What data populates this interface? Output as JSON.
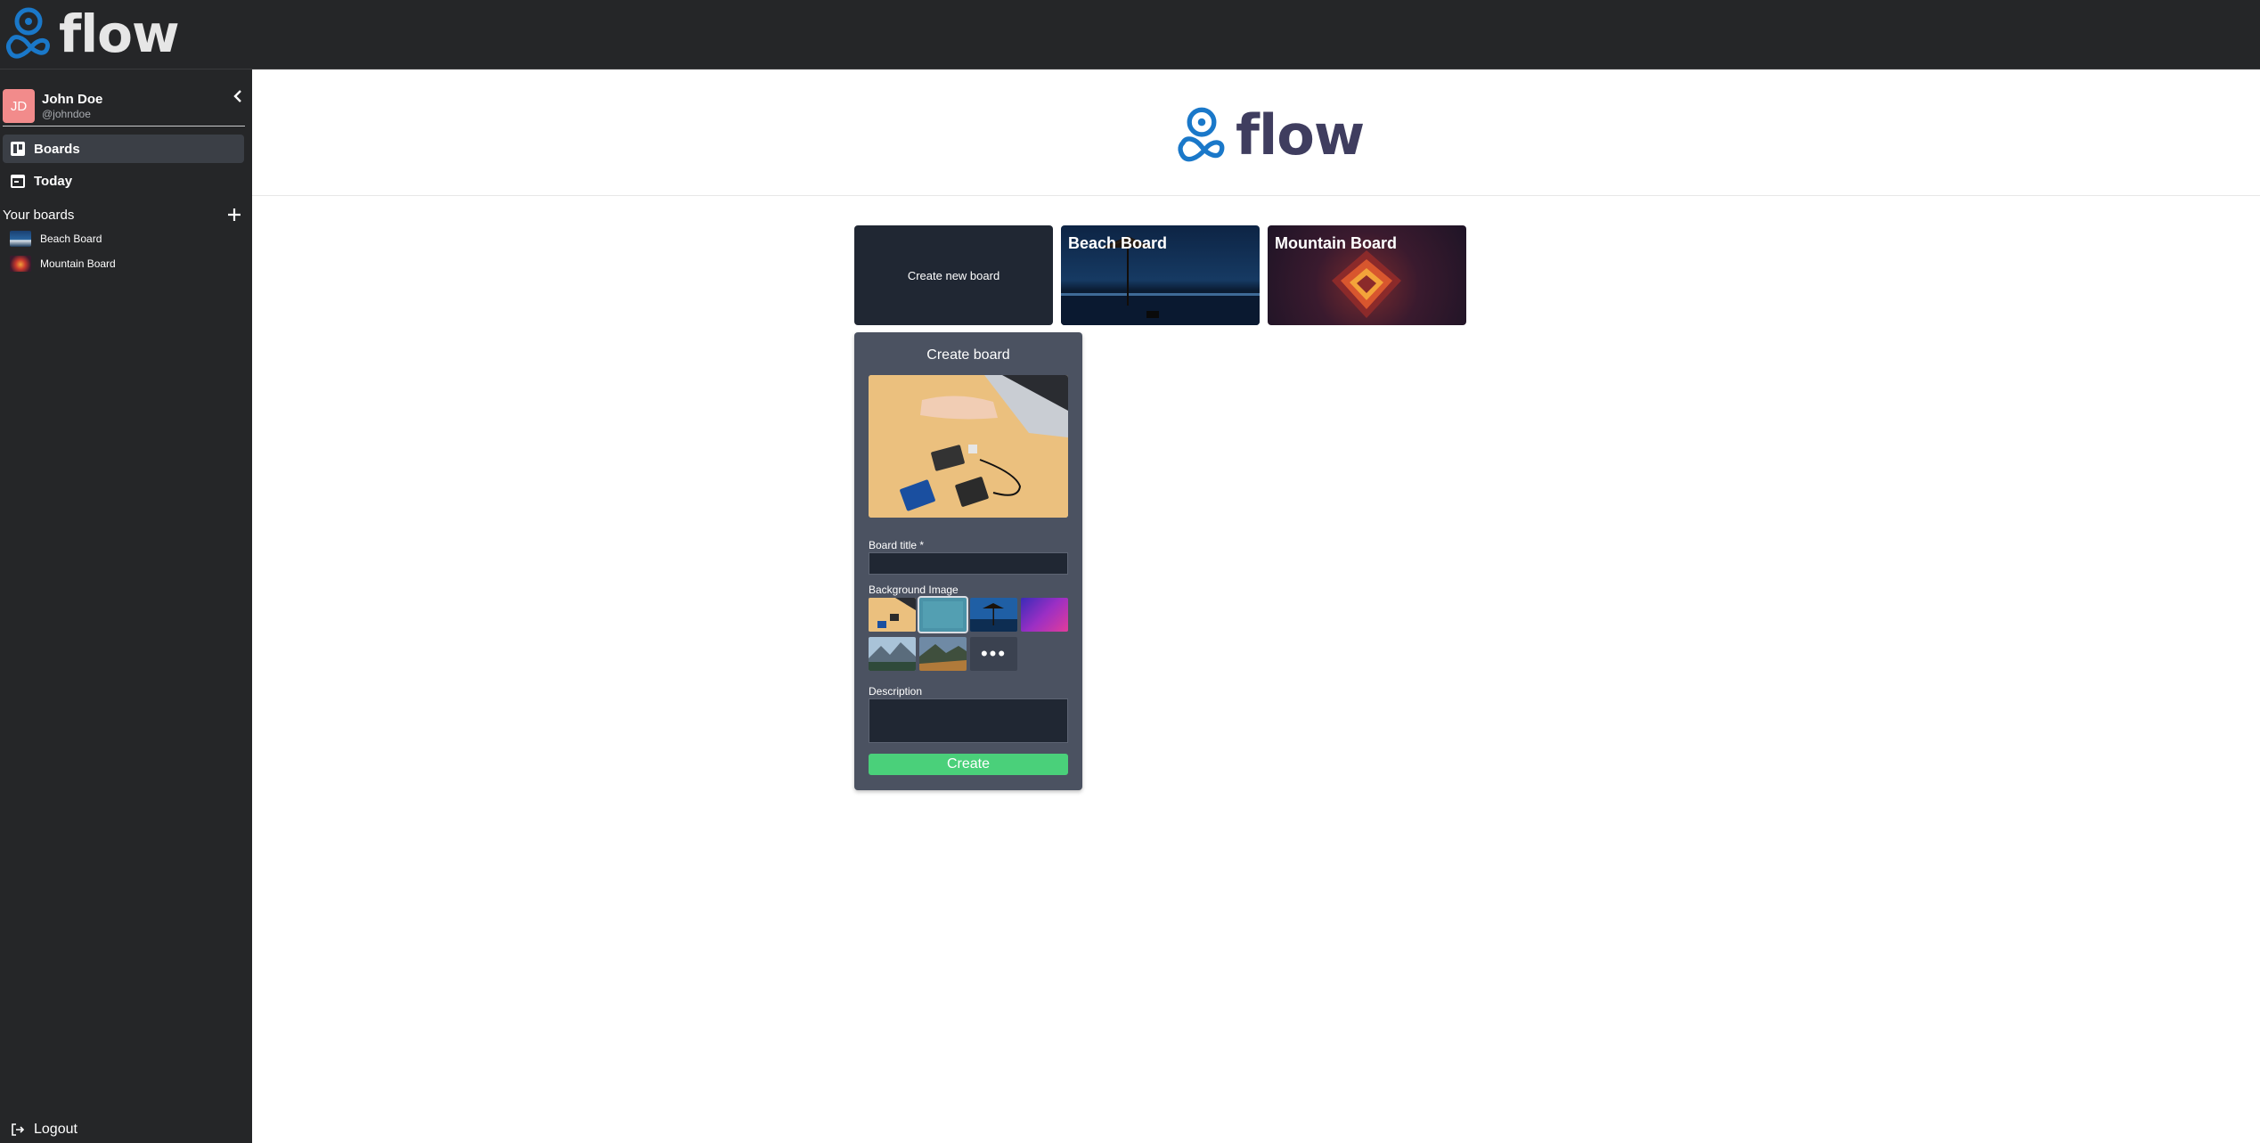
{
  "app": {
    "brand": "flow",
    "brand_color": "#1a78c9",
    "topbar_bg": "#252628"
  },
  "user": {
    "initials": "JD",
    "name": "John Doe",
    "handle": "@johndoe",
    "avatar_color": "#f28b8b"
  },
  "sidebar": {
    "collapse_icon": "chevron-left-icon",
    "nav": [
      {
        "label": "Boards",
        "icon": "boards-icon",
        "active": true
      },
      {
        "label": "Today",
        "icon": "calendar-icon",
        "active": false
      }
    ],
    "your_boards_label": "Your boards",
    "add_icon": "plus-icon",
    "boards": [
      {
        "label": "Beach Board"
      },
      {
        "label": "Mountain Board"
      }
    ],
    "logout_label": "Logout"
  },
  "main": {
    "cards": {
      "create_label": "Create new board",
      "beach_title": "Beach Board",
      "mountain_title": "Mountain Board"
    }
  },
  "popup": {
    "title": "Create board",
    "board_title_label": "Board title *",
    "board_title_value": "",
    "background_label": "Background Image",
    "more_label": "•••",
    "description_label": "Description",
    "description_value": "",
    "create_label": "Create",
    "create_color": "#4ad07a"
  }
}
